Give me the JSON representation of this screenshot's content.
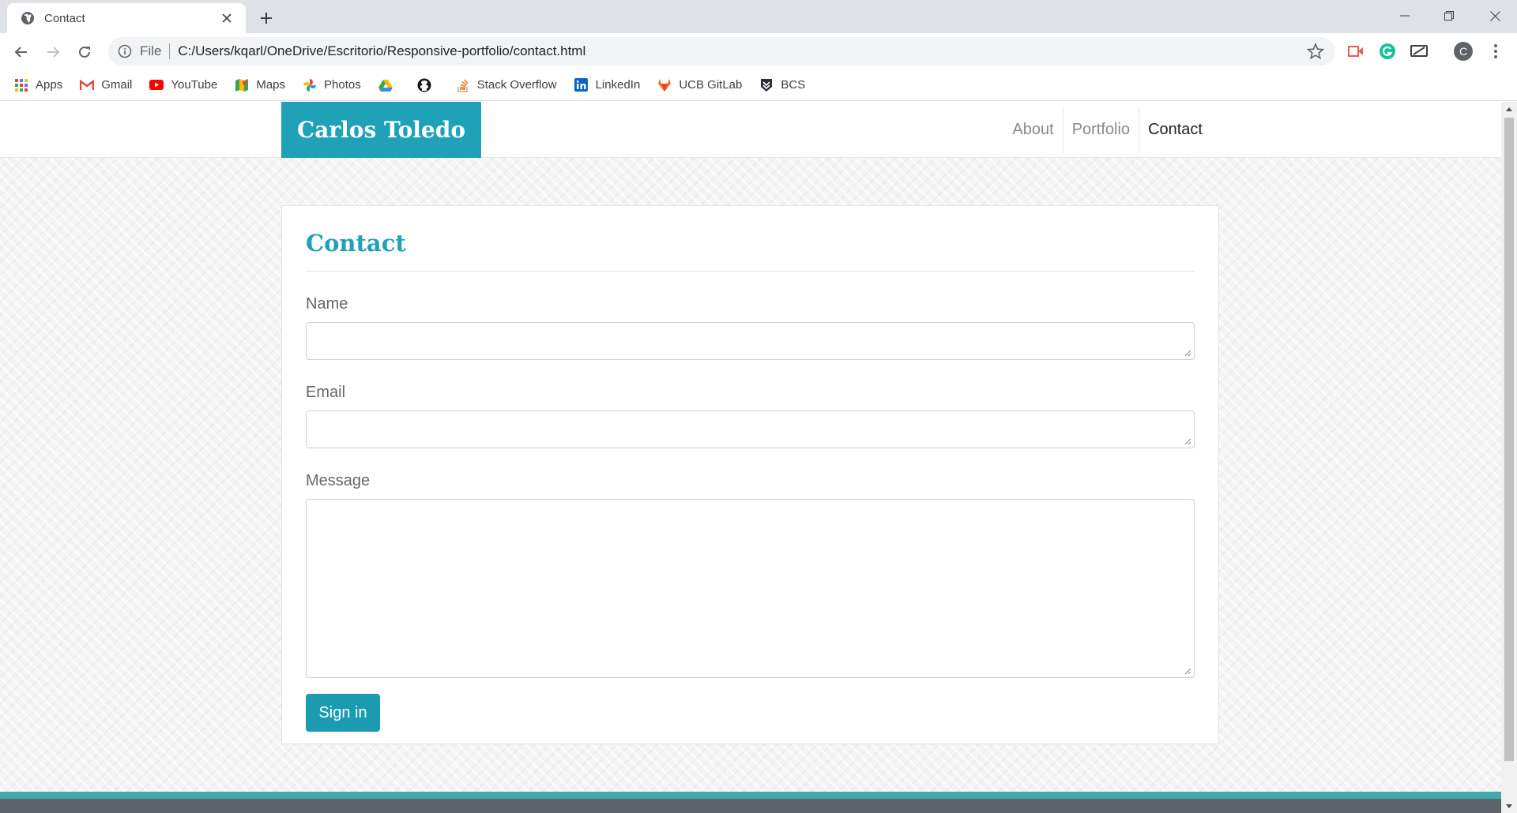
{
  "browser": {
    "tab_title": "Contact",
    "url_scheme": "File",
    "url": "C:/Users/kqarl/OneDrive/Escritorio/Responsive-portfolio/contact.html",
    "profile_initial": "C",
    "bookmarks": [
      {
        "label": "Apps",
        "icon": "apps-grid-icon"
      },
      {
        "label": "Gmail",
        "icon": "gmail-icon"
      },
      {
        "label": "YouTube",
        "icon": "youtube-icon"
      },
      {
        "label": "Maps",
        "icon": "maps-icon"
      },
      {
        "label": "Photos",
        "icon": "photos-icon"
      },
      {
        "label": "",
        "icon": "drive-icon"
      },
      {
        "label": "",
        "icon": "github-icon"
      },
      {
        "label": "Stack Overflow",
        "icon": "stackoverflow-icon"
      },
      {
        "label": "LinkedIn",
        "icon": "linkedin-icon"
      },
      {
        "label": "UCB GitLab",
        "icon": "gitlab-icon"
      },
      {
        "label": "BCS",
        "icon": "bcs-icon"
      }
    ]
  },
  "site": {
    "brand": "Carlos Toledo",
    "nav": [
      {
        "label": "About",
        "active": false
      },
      {
        "label": "Portfolio",
        "active": false
      },
      {
        "label": "Contact",
        "active": true
      }
    ],
    "accent_color": "#1fa2b8"
  },
  "contact": {
    "heading": "Contact",
    "fields": [
      {
        "label": "Name",
        "value": ""
      },
      {
        "label": "Email",
        "value": ""
      },
      {
        "label": "Message",
        "value": ""
      }
    ],
    "submit_label": "Sign in"
  }
}
